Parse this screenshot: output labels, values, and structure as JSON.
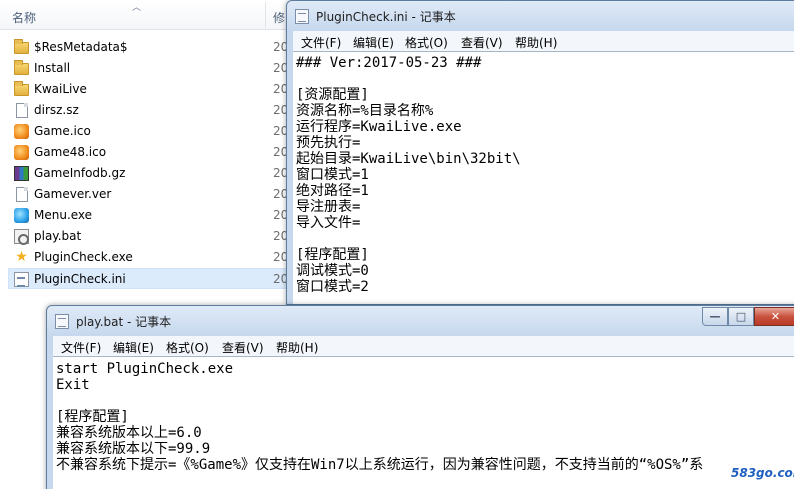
{
  "explorer": {
    "column_name": "名称",
    "column_modified": "修",
    "files": [
      {
        "name": "$ResMetadata$",
        "date": "20",
        "icon": "folder-icon",
        "selected": false
      },
      {
        "name": "Install",
        "date": "20",
        "icon": "folder-icon",
        "selected": false
      },
      {
        "name": "KwaiLive",
        "date": "20",
        "icon": "folder-icon",
        "selected": false
      },
      {
        "name": "dirsz.sz",
        "date": "20",
        "icon": "document-icon",
        "selected": false
      },
      {
        "name": "Game.ico",
        "date": "20",
        "icon": "game-icon",
        "selected": false
      },
      {
        "name": "Game48.ico",
        "date": "20",
        "icon": "game-icon",
        "selected": false
      },
      {
        "name": "GameInfodb.gz",
        "date": "20",
        "icon": "archive-icon",
        "selected": false
      },
      {
        "name": "Gamever.ver",
        "date": "20",
        "icon": "document-icon",
        "selected": false
      },
      {
        "name": "Menu.exe",
        "date": "20",
        "icon": "menu-app-icon",
        "selected": false
      },
      {
        "name": "play.bat",
        "date": "20",
        "icon": "batch-file-icon",
        "selected": false
      },
      {
        "name": "PluginCheck.exe",
        "date": "20",
        "icon": "star-app-icon",
        "selected": false
      },
      {
        "name": "PluginCheck.ini",
        "date": "20",
        "icon": "ini-file-icon",
        "selected": true
      }
    ]
  },
  "notepad_ini": {
    "title": "PluginCheck.ini - 记事本",
    "menu": [
      "文件(F)",
      "编辑(E)",
      "格式(O)",
      "查看(V)",
      "帮助(H)"
    ],
    "lines": [
      "### Ver:2017-05-23 ###",
      "",
      "[资源配置]",
      "资源名称=%目录名称%",
      "运行程序=KwaiLive.exe",
      "预先执行=",
      "起始目录=KwaiLive\\bin\\32bit\\",
      "窗口模式=1",
      "绝对路径=1",
      "导注册表=",
      "导入文件=",
      "",
      "[程序配置]",
      "调试模式=0",
      "窗口模式=2"
    ]
  },
  "notepad_bat": {
    "title": "play.bat - 记事本",
    "menu": [
      "文件(F)",
      "编辑(E)",
      "格式(O)",
      "查看(V)",
      "帮助(H)"
    ],
    "window_controls": {
      "minimize": "—",
      "maximize": "□",
      "close": "✕"
    },
    "lines": [
      "start PluginCheck.exe",
      "Exit",
      "",
      "[程序配置]",
      "兼容系统版本以上=6.0",
      "兼容系统版本以下=99.9",
      "不兼容系统下提示=《%Game%》仅支持在Win7以上系统运行，因为兼容性问题，不支持当前的“%OS%”系"
    ]
  },
  "watermark": "583go.com"
}
